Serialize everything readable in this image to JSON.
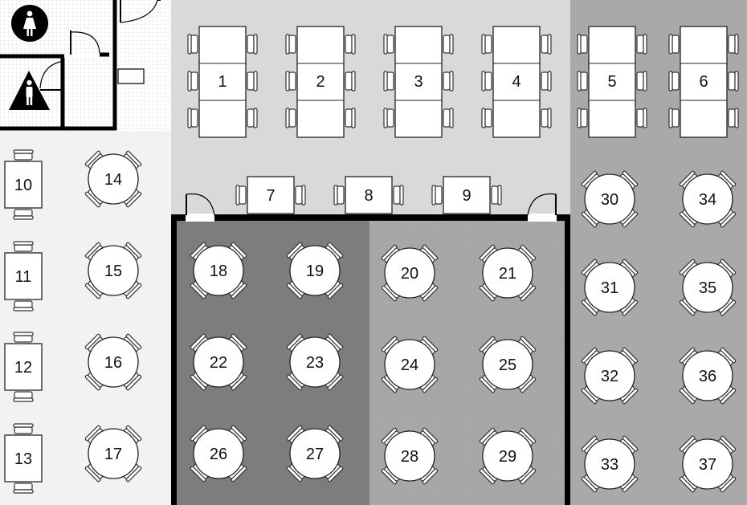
{
  "floor_plan": {
    "zone_colors": {
      "top_hall": "#d9d9d9",
      "left_room": "#f2f2f2",
      "right_room": "#a9a9a9",
      "dark_section": "#7d7d7d",
      "mid_section": "#a8a8a8",
      "restroom": "#ffffff"
    },
    "restrooms": [
      {
        "icon": "woman-restroom-icon"
      },
      {
        "icon": "man-restroom-icon"
      }
    ],
    "tables": [
      {
        "number": "1",
        "shape": "rect-6"
      },
      {
        "number": "2",
        "shape": "rect-6"
      },
      {
        "number": "3",
        "shape": "rect-6"
      },
      {
        "number": "4",
        "shape": "rect-6"
      },
      {
        "number": "5",
        "shape": "rect-6"
      },
      {
        "number": "6",
        "shape": "rect-6"
      },
      {
        "number": "7",
        "shape": "rect-2h"
      },
      {
        "number": "8",
        "shape": "rect-2h"
      },
      {
        "number": "9",
        "shape": "rect-2h"
      },
      {
        "number": "10",
        "shape": "rect-2v"
      },
      {
        "number": "11",
        "shape": "rect-2v"
      },
      {
        "number": "12",
        "shape": "rect-2v"
      },
      {
        "number": "13",
        "shape": "rect-2v"
      },
      {
        "number": "14",
        "shape": "round-4"
      },
      {
        "number": "15",
        "shape": "round-4"
      },
      {
        "number": "16",
        "shape": "round-4"
      },
      {
        "number": "17",
        "shape": "round-4"
      },
      {
        "number": "18",
        "shape": "round-4"
      },
      {
        "number": "19",
        "shape": "round-4"
      },
      {
        "number": "20",
        "shape": "round-4"
      },
      {
        "number": "21",
        "shape": "round-4"
      },
      {
        "number": "22",
        "shape": "round-4"
      },
      {
        "number": "23",
        "shape": "round-4"
      },
      {
        "number": "24",
        "shape": "round-4"
      },
      {
        "number": "25",
        "shape": "round-4"
      },
      {
        "number": "26",
        "shape": "round-4"
      },
      {
        "number": "27",
        "shape": "round-4"
      },
      {
        "number": "28",
        "shape": "round-4"
      },
      {
        "number": "29",
        "shape": "round-4"
      },
      {
        "number": "30",
        "shape": "round-4"
      },
      {
        "number": "31",
        "shape": "round-4"
      },
      {
        "number": "32",
        "shape": "round-4"
      },
      {
        "number": "33",
        "shape": "round-4"
      },
      {
        "number": "34",
        "shape": "round-4"
      },
      {
        "number": "35",
        "shape": "round-4"
      },
      {
        "number": "36",
        "shape": "round-4"
      },
      {
        "number": "37",
        "shape": "round-4"
      }
    ]
  }
}
